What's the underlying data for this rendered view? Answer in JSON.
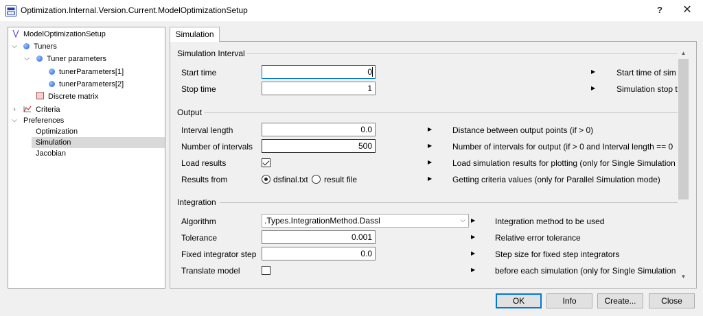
{
  "window": {
    "title": "Optimization.Internal.Version.Current.ModelOptimizationSetup",
    "help_label": "?",
    "close_label": "✕"
  },
  "tree": {
    "root": "ModelOptimizationSetup",
    "tuners": "Tuners",
    "tuner_parameters": "Tuner parameters",
    "tuner_param_1": "tunerParameters[1]",
    "tuner_param_2": "tunerParameters[2]",
    "discrete_matrix": "Discrete matrix",
    "criteria": "Criteria",
    "preferences": "Preferences",
    "optimization": "Optimization",
    "simulation": "Simulation",
    "jacobian": "Jacobian"
  },
  "tab": {
    "label": "Simulation"
  },
  "sim_interval": {
    "heading": "Simulation Interval",
    "start_label": "Start time",
    "start_value": "0",
    "start_desc": "Start time of sim",
    "stop_label": "Stop time",
    "stop_value": "1",
    "stop_desc": "Simulation stop t"
  },
  "output": {
    "heading": "Output",
    "interval_length_label": "Interval length",
    "interval_length_value": "0.0",
    "interval_length_desc": "Distance between output points (if > 0)",
    "num_intervals_label": "Number of intervals",
    "num_intervals_value": "500",
    "num_intervals_desc": "Number of intervals for output (if > 0 and Interval length == 0",
    "load_results_label": "Load results",
    "load_results_checked": true,
    "load_results_desc": "Load simulation results for plotting (only for Single Simulation",
    "results_from_label": "Results from",
    "results_opt1": "dsfinal.txt",
    "results_opt2": "result file",
    "results_from_desc": "Getting criteria values (only for Parallel Simulation mode)"
  },
  "integration": {
    "heading": "Integration",
    "algorithm_label": "Algorithm",
    "algorithm_value": ".Types.IntegrationMethod.Dassl",
    "algorithm_desc": "Integration method to be used",
    "tolerance_label": "Tolerance",
    "tolerance_value": "0.001",
    "tolerance_desc": "Relative error tolerance",
    "fixed_step_label": "Fixed integrator step",
    "fixed_step_value": "0.0",
    "fixed_step_desc": "Step size for fixed step integrators",
    "translate_label": "Translate model",
    "translate_checked": false,
    "translate_desc": "before each simulation (only for Single Simulation"
  },
  "buttons": {
    "ok": "OK",
    "info": "Info",
    "create": "Create...",
    "close": "Close"
  }
}
